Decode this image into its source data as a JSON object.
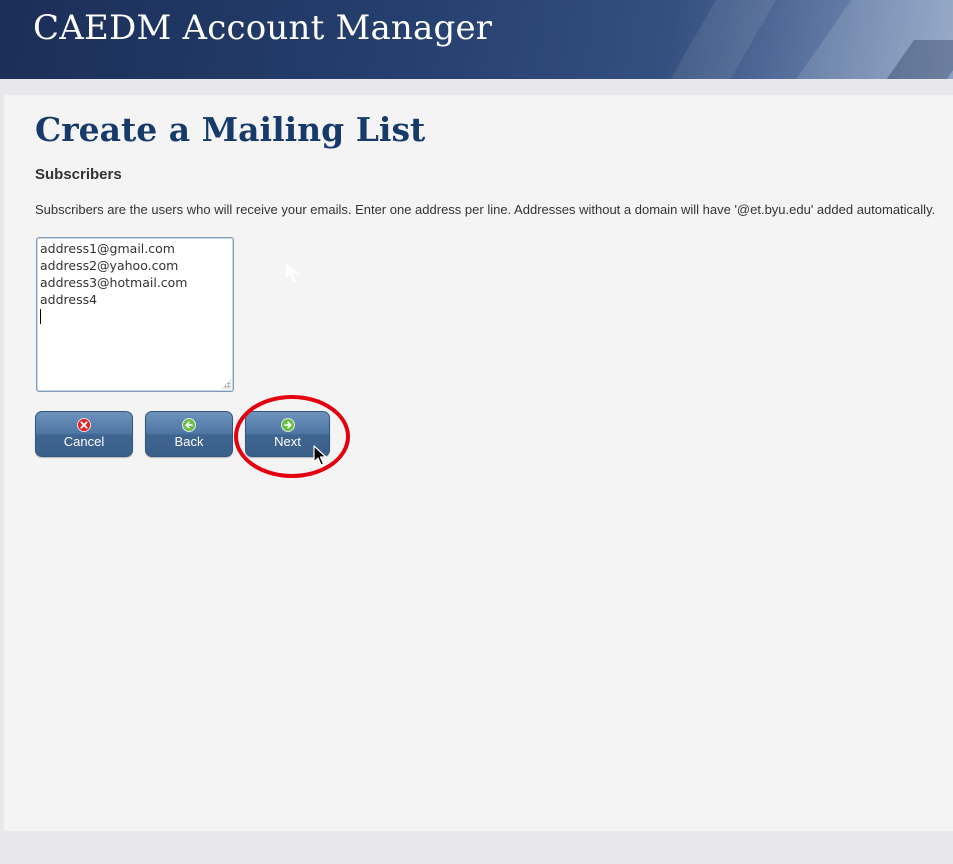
{
  "header": {
    "title": "CAEDM Account Manager"
  },
  "page": {
    "title": "Create a Mailing List",
    "section_heading": "Subscribers",
    "description": "Subscribers are the users who will receive your emails. Enter one address per line. Addresses without a domain will have '@et.byu.edu' added automatically."
  },
  "subscribers": {
    "lines": [
      "address1@gmail.com",
      "address2@yahoo.com",
      "address3@hotmail.com",
      "address4"
    ]
  },
  "buttons": {
    "cancel": {
      "label": "Cancel",
      "icon": "cancel-x-icon",
      "icon_color": "#e0242a"
    },
    "back": {
      "label": "Back",
      "icon": "arrow-left-icon",
      "icon_color": "#6cc04a"
    },
    "next": {
      "label": "Next",
      "icon": "arrow-right-icon",
      "icon_color": "#6cc04a"
    }
  },
  "annotation": {
    "highlight": "next-button",
    "color": "#e4000f"
  },
  "colors": {
    "title": "#183a6b",
    "button": "#4e76a3",
    "panel": "#f4f4f4"
  }
}
